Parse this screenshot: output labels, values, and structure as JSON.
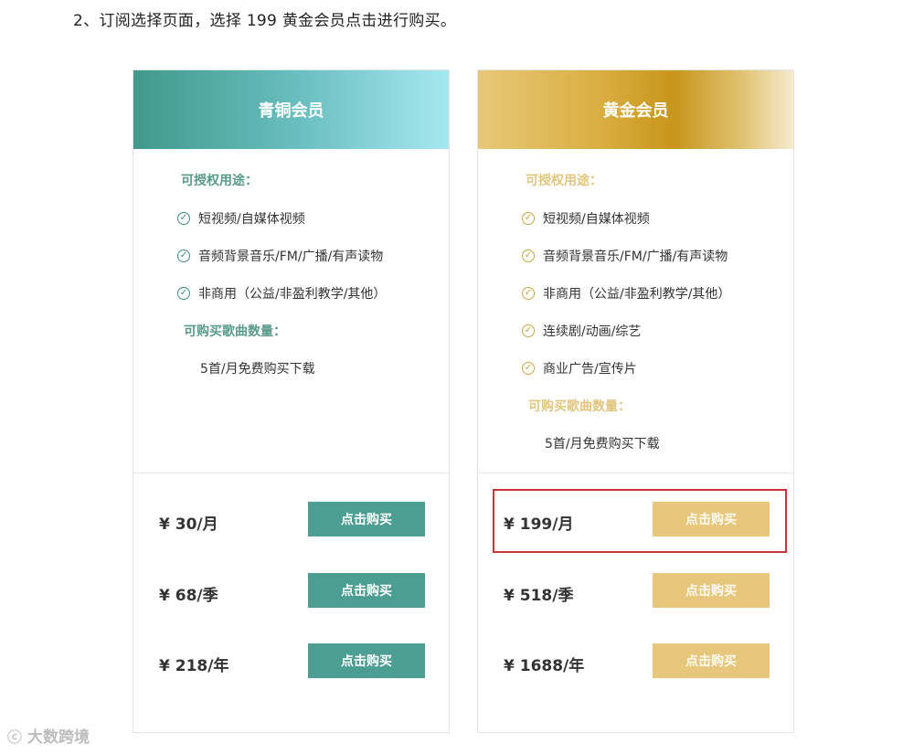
{
  "instruction": "2、订阅选择页面，选择 199 黄金会员点击进行购买。",
  "plans": {
    "bronze": {
      "title": "青铜会员",
      "usage_title": "可授权用途：",
      "features": [
        "短视频/自媒体视频",
        "音频背景音乐/FM/广播/有声读物",
        "非商用（公益/非盈利教学/其他）"
      ],
      "quota_title": "可购买歌曲数量：",
      "quota": "5首/月免费购买下载",
      "prices": [
        {
          "price": "¥ 30/月",
          "button": "点击购买"
        },
        {
          "price": "¥ 68/季",
          "button": "点击购买"
        },
        {
          "price": "¥ 218/年",
          "button": "点击购买"
        }
      ]
    },
    "gold": {
      "title": "黄金会员",
      "usage_title": "可授权用途：",
      "features": [
        "短视频/自媒体视频",
        "音频背景音乐/FM/广播/有声读物",
        "非商用（公益/非盈利教学/其他）",
        "连续剧/动画/综艺",
        "商业广告/宣传片"
      ],
      "quota_title": "可购买歌曲数量：",
      "quota": "5首/月免费购买下载",
      "prices": [
        {
          "price": "¥ 199/月",
          "button": "点击购买"
        },
        {
          "price": "¥ 518/季",
          "button": "点击购买"
        },
        {
          "price": "¥ 1688/年",
          "button": "点击购买"
        }
      ]
    }
  },
  "watermark": "大数跨境",
  "icons": {
    "check": "check-circle-icon",
    "watermark": "brand-logo-icon"
  },
  "colors": {
    "bronze_accent": "#4c9d92",
    "gold_accent": "#e6c77c",
    "highlight": "#c8343e"
  }
}
